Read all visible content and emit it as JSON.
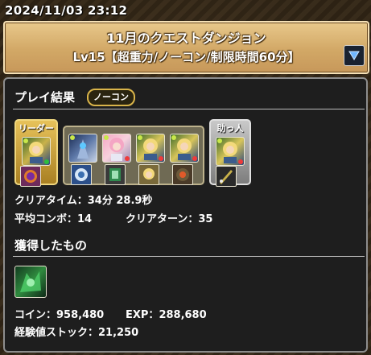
{
  "status_bar": {
    "timestamp": "2024/11/03 23:12"
  },
  "header": {
    "title": "11月のクエストダンジョン",
    "subtitle": "Lv15【超重力/ノーコン/制限時間60分】",
    "dropdown_icon": "triangle-down-icon"
  },
  "result": {
    "section_title": "プレイ結果",
    "badge": "ノーコン",
    "team": {
      "leader_label": "リーダー",
      "helper_label": "助っ人",
      "leader": {
        "icon": "leader-monster-icon",
        "assist_icon": "assist-orb-icon"
      },
      "subs": [
        {
          "icon": "sub-monster-1-icon",
          "assist_icon": "assist-1-icon"
        },
        {
          "icon": "sub-monster-2-icon",
          "assist_icon": "assist-2-icon"
        },
        {
          "icon": "sub-monster-3-icon",
          "assist_icon": "assist-3-icon"
        },
        {
          "icon": "sub-monster-4-icon",
          "assist_icon": "assist-4-icon"
        }
      ],
      "helper": {
        "icon": "helper-monster-icon",
        "assist_icon": "helper-assist-icon"
      }
    },
    "clear_time_label": "クリアタイム：",
    "clear_time_value": "34分 28.9秒",
    "avg_combo_label": "平均コンボ：",
    "avg_combo_value": "14",
    "clear_turns_label": "クリアターン：",
    "clear_turns_value": "35"
  },
  "rewards": {
    "section_title": "獲得したもの",
    "item_icon": "reward-monster-icon",
    "coin_label": "コイン：",
    "coin_value": "958,480",
    "exp_label": "EXP：",
    "exp_value": "288,680",
    "stock_label": "経験値ストック：",
    "stock_value": "21,250"
  },
  "colors": {
    "header_gold": "#d2a866",
    "panel_bg": "#1e1e1e",
    "leader_frame": "#c9a13a",
    "helper_frame": "#9a9a9a"
  }
}
